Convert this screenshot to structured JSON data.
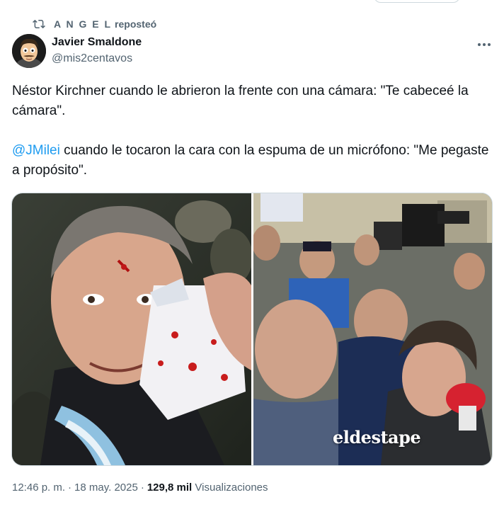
{
  "repost": {
    "icon": "repost-icon",
    "user": "A N G E L",
    "verb": "reposteó"
  },
  "author": {
    "display_name": "Javier Smaldone",
    "handle": "@mis2centavos",
    "avatar_icon": "cartoon-avatar"
  },
  "more_icon": "more-horizontal-icon",
  "tweet": {
    "line1": "Néstor Kirchner cuando le abrieron la frente con una cámara: \"Te cabeceé la cámara\".",
    "mention": "@JMilei",
    "line2_rest": " cuando le tocaron la cara con la espuma de un micrófono: \"Me pegaste a propósito\"."
  },
  "media": {
    "left_photo_alt": "photo-kirchner-bleeding",
    "right_photo_alt": "photo-milei-microphone",
    "watermark": "eldestape"
  },
  "meta": {
    "time": "12:46 p. m.",
    "date": "18 may. 2025",
    "views_count": "129,8 mil",
    "views_label": "Visualizaciones"
  },
  "colors": {
    "link": "#1d9bf0",
    "text": "#0f1419",
    "secondary": "#536471",
    "border": "#cfd9de"
  }
}
